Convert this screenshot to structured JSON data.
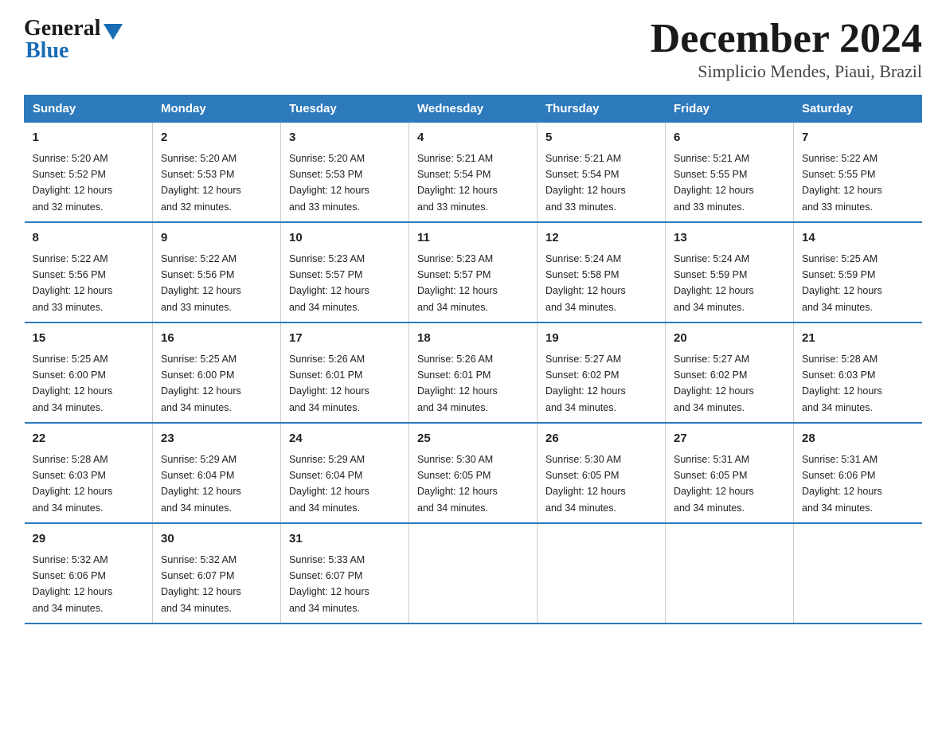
{
  "logo": {
    "general": "General",
    "blue": "Blue"
  },
  "header": {
    "title": "December 2024",
    "subtitle": "Simplicio Mendes, Piaui, Brazil"
  },
  "weekdays": [
    "Sunday",
    "Monday",
    "Tuesday",
    "Wednesday",
    "Thursday",
    "Friday",
    "Saturday"
  ],
  "weeks": [
    [
      {
        "day": "1",
        "sunrise": "5:20 AM",
        "sunset": "5:52 PM",
        "daylight": "12 hours and 32 minutes."
      },
      {
        "day": "2",
        "sunrise": "5:20 AM",
        "sunset": "5:53 PM",
        "daylight": "12 hours and 32 minutes."
      },
      {
        "day": "3",
        "sunrise": "5:20 AM",
        "sunset": "5:53 PM",
        "daylight": "12 hours and 33 minutes."
      },
      {
        "day": "4",
        "sunrise": "5:21 AM",
        "sunset": "5:54 PM",
        "daylight": "12 hours and 33 minutes."
      },
      {
        "day": "5",
        "sunrise": "5:21 AM",
        "sunset": "5:54 PM",
        "daylight": "12 hours and 33 minutes."
      },
      {
        "day": "6",
        "sunrise": "5:21 AM",
        "sunset": "5:55 PM",
        "daylight": "12 hours and 33 minutes."
      },
      {
        "day": "7",
        "sunrise": "5:22 AM",
        "sunset": "5:55 PM",
        "daylight": "12 hours and 33 minutes."
      }
    ],
    [
      {
        "day": "8",
        "sunrise": "5:22 AM",
        "sunset": "5:56 PM",
        "daylight": "12 hours and 33 minutes."
      },
      {
        "day": "9",
        "sunrise": "5:22 AM",
        "sunset": "5:56 PM",
        "daylight": "12 hours and 33 minutes."
      },
      {
        "day": "10",
        "sunrise": "5:23 AM",
        "sunset": "5:57 PM",
        "daylight": "12 hours and 34 minutes."
      },
      {
        "day": "11",
        "sunrise": "5:23 AM",
        "sunset": "5:57 PM",
        "daylight": "12 hours and 34 minutes."
      },
      {
        "day": "12",
        "sunrise": "5:24 AM",
        "sunset": "5:58 PM",
        "daylight": "12 hours and 34 minutes."
      },
      {
        "day": "13",
        "sunrise": "5:24 AM",
        "sunset": "5:59 PM",
        "daylight": "12 hours and 34 minutes."
      },
      {
        "day": "14",
        "sunrise": "5:25 AM",
        "sunset": "5:59 PM",
        "daylight": "12 hours and 34 minutes."
      }
    ],
    [
      {
        "day": "15",
        "sunrise": "5:25 AM",
        "sunset": "6:00 PM",
        "daylight": "12 hours and 34 minutes."
      },
      {
        "day": "16",
        "sunrise": "5:25 AM",
        "sunset": "6:00 PM",
        "daylight": "12 hours and 34 minutes."
      },
      {
        "day": "17",
        "sunrise": "5:26 AM",
        "sunset": "6:01 PM",
        "daylight": "12 hours and 34 minutes."
      },
      {
        "day": "18",
        "sunrise": "5:26 AM",
        "sunset": "6:01 PM",
        "daylight": "12 hours and 34 minutes."
      },
      {
        "day": "19",
        "sunrise": "5:27 AM",
        "sunset": "6:02 PM",
        "daylight": "12 hours and 34 minutes."
      },
      {
        "day": "20",
        "sunrise": "5:27 AM",
        "sunset": "6:02 PM",
        "daylight": "12 hours and 34 minutes."
      },
      {
        "day": "21",
        "sunrise": "5:28 AM",
        "sunset": "6:03 PM",
        "daylight": "12 hours and 34 minutes."
      }
    ],
    [
      {
        "day": "22",
        "sunrise": "5:28 AM",
        "sunset": "6:03 PM",
        "daylight": "12 hours and 34 minutes."
      },
      {
        "day": "23",
        "sunrise": "5:29 AM",
        "sunset": "6:04 PM",
        "daylight": "12 hours and 34 minutes."
      },
      {
        "day": "24",
        "sunrise": "5:29 AM",
        "sunset": "6:04 PM",
        "daylight": "12 hours and 34 minutes."
      },
      {
        "day": "25",
        "sunrise": "5:30 AM",
        "sunset": "6:05 PM",
        "daylight": "12 hours and 34 minutes."
      },
      {
        "day": "26",
        "sunrise": "5:30 AM",
        "sunset": "6:05 PM",
        "daylight": "12 hours and 34 minutes."
      },
      {
        "day": "27",
        "sunrise": "5:31 AM",
        "sunset": "6:05 PM",
        "daylight": "12 hours and 34 minutes."
      },
      {
        "day": "28",
        "sunrise": "5:31 AM",
        "sunset": "6:06 PM",
        "daylight": "12 hours and 34 minutes."
      }
    ],
    [
      {
        "day": "29",
        "sunrise": "5:32 AM",
        "sunset": "6:06 PM",
        "daylight": "12 hours and 34 minutes."
      },
      {
        "day": "30",
        "sunrise": "5:32 AM",
        "sunset": "6:07 PM",
        "daylight": "12 hours and 34 minutes."
      },
      {
        "day": "31",
        "sunrise": "5:33 AM",
        "sunset": "6:07 PM",
        "daylight": "12 hours and 34 minutes."
      },
      null,
      null,
      null,
      null
    ]
  ],
  "labels": {
    "sunrise": "Sunrise:",
    "sunset": "Sunset:",
    "daylight": "Daylight:"
  }
}
